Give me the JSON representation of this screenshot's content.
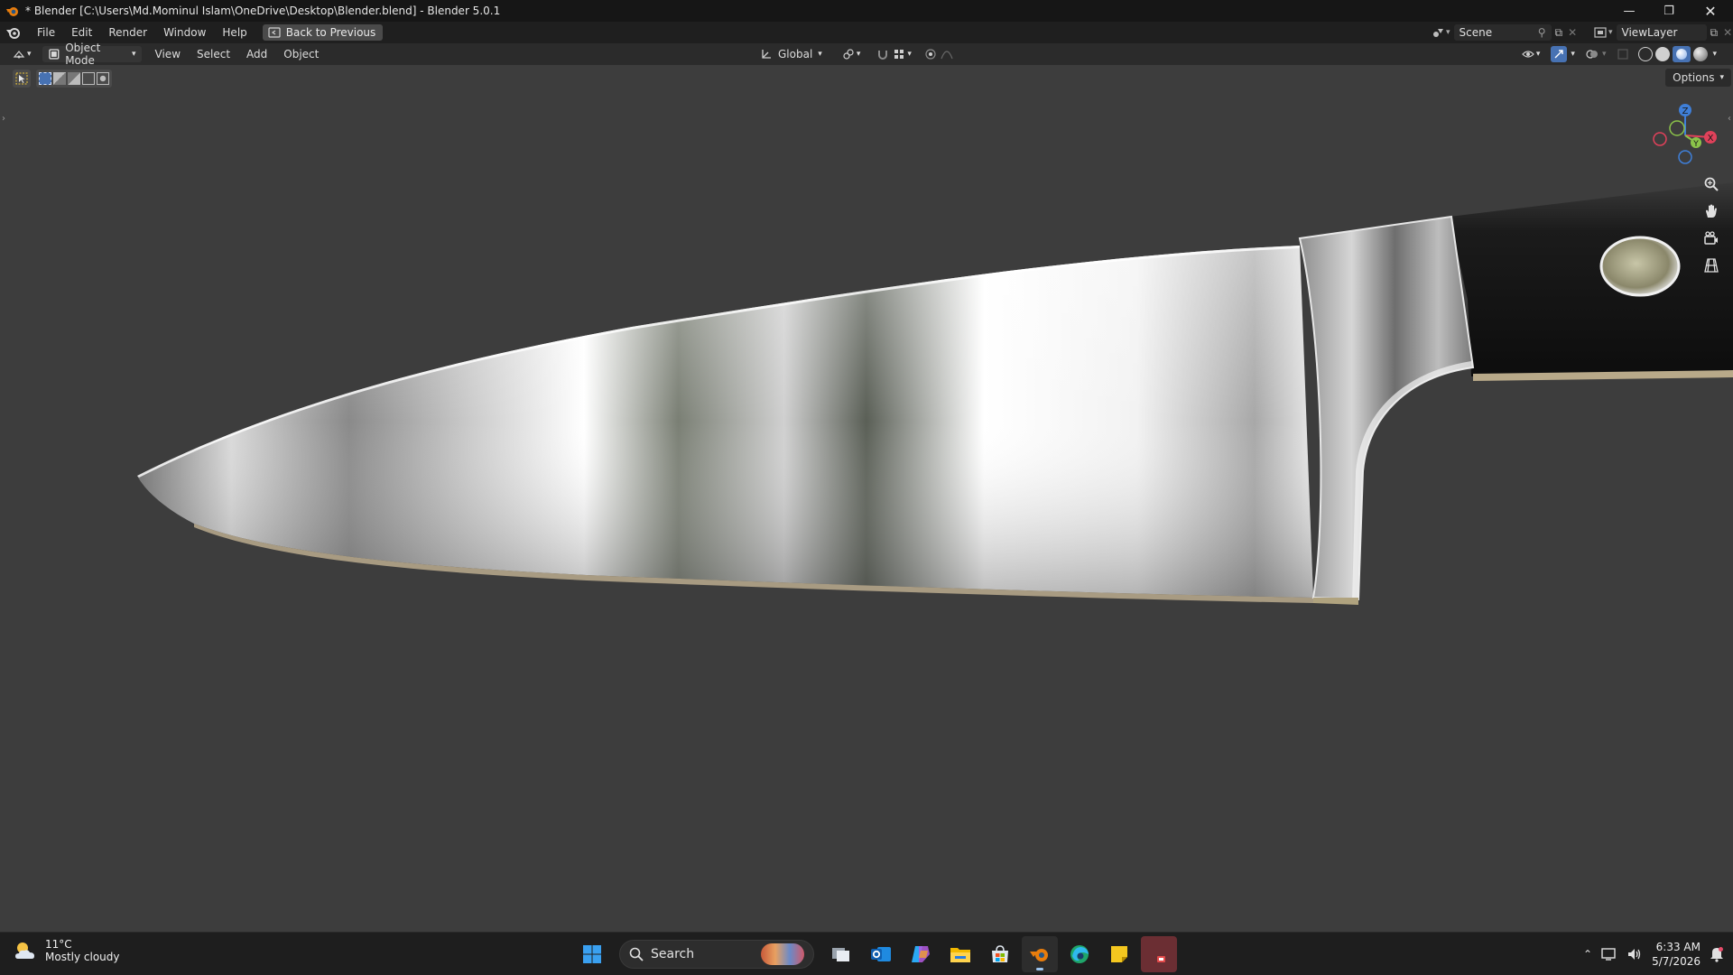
{
  "window": {
    "title": "* Blender [C:\\Users\\Md.Mominul Islam\\OneDrive\\Desktop\\Blender.blend] - Blender 5.0.1"
  },
  "menubar": {
    "items": [
      "File",
      "Edit",
      "Render",
      "Window",
      "Help"
    ],
    "back_button": "Back to Previous",
    "scene": "Scene",
    "view_layer": "ViewLayer"
  },
  "viewport_header": {
    "mode": "Object Mode",
    "menus": [
      "View",
      "Select",
      "Add",
      "Object"
    ],
    "transform_orientation": "Global"
  },
  "viewport": {
    "options_label": "Options",
    "gizmo_axes": [
      "Z",
      "Y",
      "X"
    ],
    "colors": {
      "x_axis": "#e0415a",
      "y_axis": "#8bc34a",
      "z_axis": "#3f7fd8",
      "background": "#3d3d3d"
    }
  },
  "taskbar": {
    "weather_temp": "11°C",
    "weather_condition": "Mostly cloudy",
    "search_label": "Search",
    "time": "6:33 AM",
    "date": "5/7/2026"
  }
}
